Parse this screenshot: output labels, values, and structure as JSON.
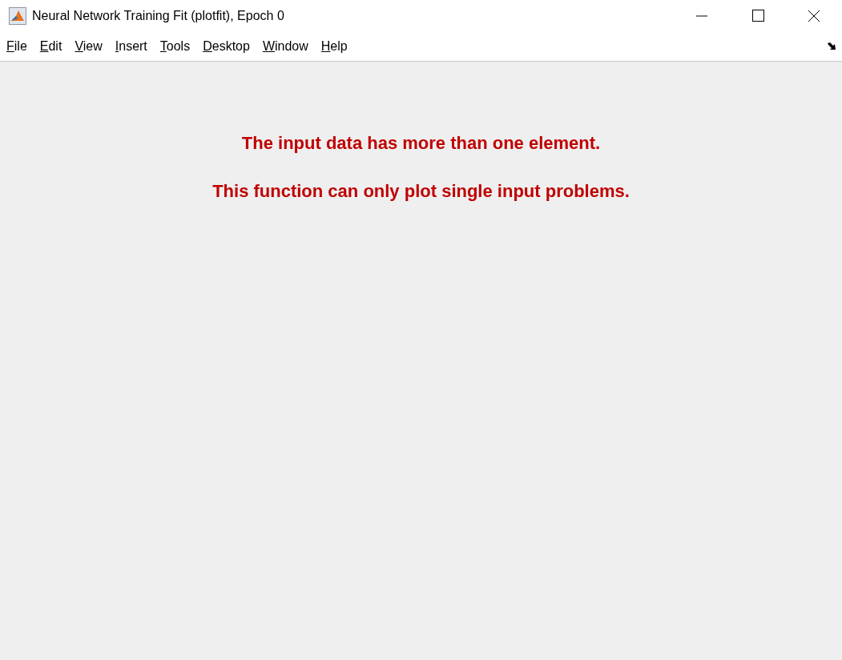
{
  "window": {
    "title": "Neural Network Training Fit (plotfit), Epoch 0"
  },
  "menu": [
    {
      "label": "File"
    },
    {
      "label": "Edit"
    },
    {
      "label": "View"
    },
    {
      "label": "Insert"
    },
    {
      "label": "Tools"
    },
    {
      "label": "Desktop"
    },
    {
      "label": "Window"
    },
    {
      "label": "Help"
    }
  ],
  "messages": [
    "The input data has more than one element.",
    "This function can only plot single input problems."
  ]
}
